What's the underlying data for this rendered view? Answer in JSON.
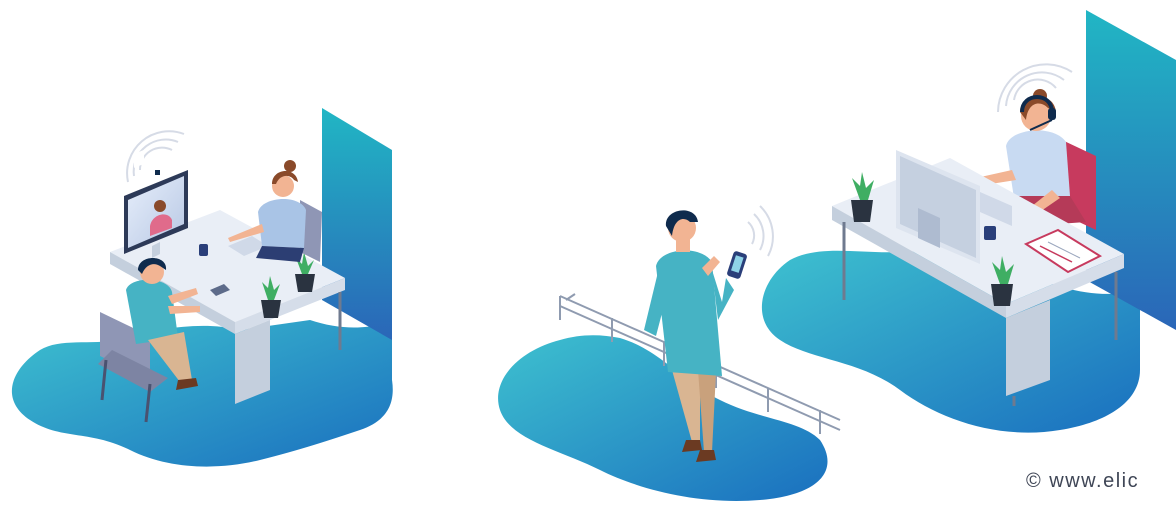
{
  "copyright": "© www.elic",
  "colors": {
    "floor_light": "#3ec1cf",
    "floor_dark": "#1a6fbf",
    "wall_top": "#21b6c4",
    "wall_bottom": "#2a66b8",
    "desk_top": "#e9eef6",
    "desk_side": "#c4cfdd",
    "desk_legs": "#6f7a8f",
    "shirt_teal": "#46b3c4",
    "shirt_light": "#a9c4e6",
    "shirt_white": "#c8daf2",
    "skin": "#f2b493",
    "hair_dark": "#0f2b4d",
    "hair_brown": "#8a4a2a",
    "pants_khaki": "#d9b592",
    "chair_grey": "#8f96b5",
    "chair_pink": "#c73a5e",
    "plant_green": "#3fae63",
    "pot_dark": "#2a3340"
  }
}
